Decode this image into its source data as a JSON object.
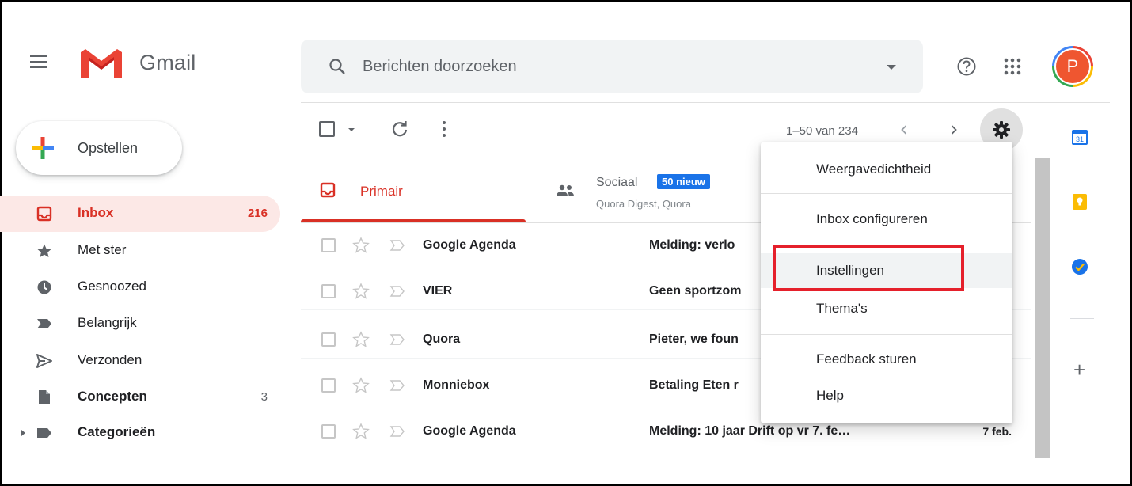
{
  "header": {
    "app_name": "Gmail",
    "search_placeholder": "Berichten doorzoeken",
    "avatar_initial": "P"
  },
  "compose": {
    "label": "Opstellen"
  },
  "sidebar": {
    "items": [
      {
        "label": "Inbox",
        "count": "216",
        "icon": "inbox-icon",
        "active": true
      },
      {
        "label": "Met ster",
        "count": "",
        "icon": "star-icon"
      },
      {
        "label": "Gesnoozed",
        "count": "",
        "icon": "clock-icon"
      },
      {
        "label": "Belangrijk",
        "count": "",
        "icon": "important-icon"
      },
      {
        "label": "Verzonden",
        "count": "",
        "icon": "send-icon"
      },
      {
        "label": "Concepten",
        "count": "3",
        "icon": "draft-icon"
      },
      {
        "label": "Categorieën",
        "count": "",
        "icon": "label-icon"
      }
    ]
  },
  "toolbar": {
    "pager": "1–50 van 234"
  },
  "tabs": {
    "primary": {
      "label": "Primair"
    },
    "social": {
      "label": "Sociaal",
      "badge": "50 nieuw",
      "sub": "Quora Digest, Quora"
    }
  },
  "mails": [
    {
      "sender": "Google Agenda",
      "subject": "Melding: verlo",
      "date": ""
    },
    {
      "sender": "VIER",
      "subject": "Geen sportzom",
      "date": ""
    },
    {
      "sender": "Quora",
      "subject": "Pieter, we foun",
      "date": ""
    },
    {
      "sender": "Monniebox",
      "subject": "Betaling Eten r",
      "date": ""
    },
    {
      "sender": "Google Agenda",
      "subject": "Melding: 10 jaar Drift op vr 7. fe…",
      "date": "7 feb."
    }
  ],
  "menu": {
    "items": [
      {
        "label": "Weergavedichtheid"
      },
      {
        "label": "Inbox configureren"
      },
      {
        "label": "Instellingen",
        "highlighted": true
      },
      {
        "label": "Thema's"
      },
      {
        "label": "Feedback sturen"
      },
      {
        "label": "Help"
      }
    ]
  },
  "side_panel": {
    "calendar_day": "31",
    "apps": [
      "calendar-icon",
      "keep-icon",
      "tasks-icon"
    ]
  },
  "colors": {
    "accent_red": "#d93025",
    "highlight_box": "#e5202b",
    "badge_blue": "#1a73e8"
  }
}
